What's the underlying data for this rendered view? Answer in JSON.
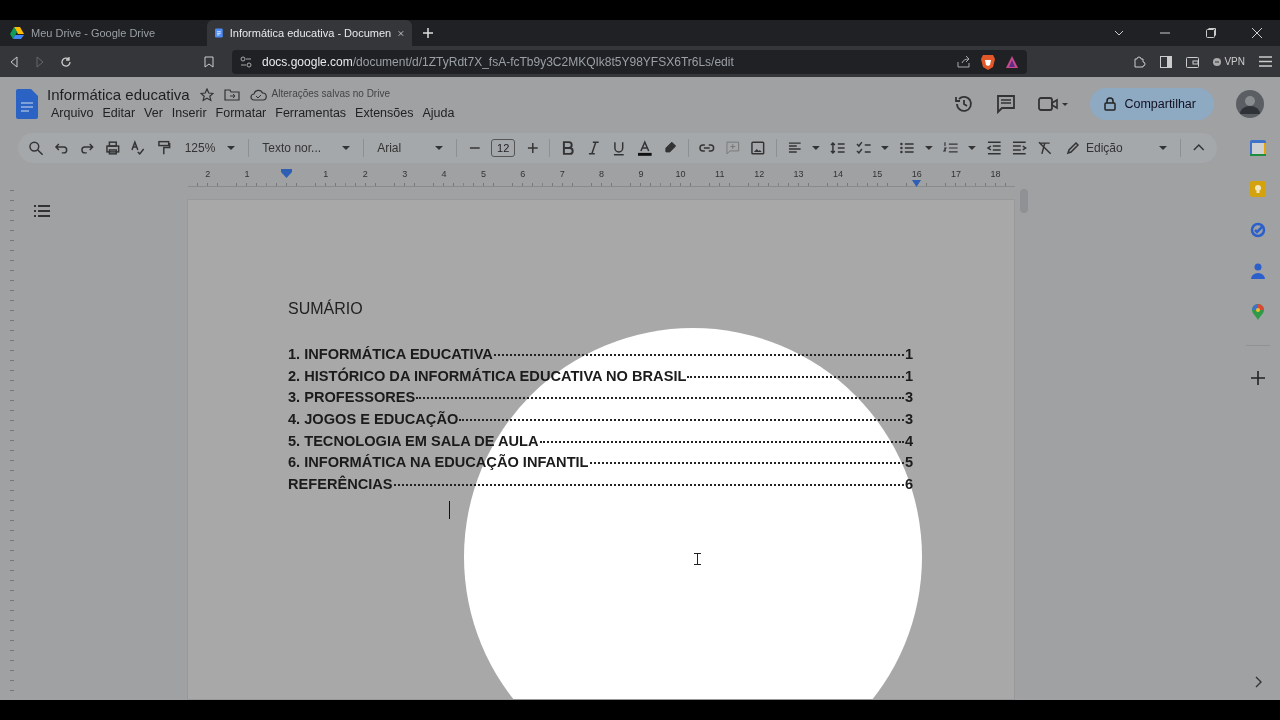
{
  "browser": {
    "tabs": [
      {
        "title": "Meu Drive - Google Drive",
        "kind": "drive",
        "selected": false
      },
      {
        "title": "Informática educativa - Documen",
        "kind": "docs",
        "selected": true
      }
    ],
    "url": {
      "host": "docs.google.com",
      "path": "/document/d/1ZTyRdt7X_fsA-fcTb9y3C2MKQIk8t5Y98YFSX6Tr6Ls/edit"
    },
    "vpn": "VPN"
  },
  "document_title": "Informática educativa",
  "save_status": "Alterações salvas no Drive",
  "menu": [
    "Arquivo",
    "Editar",
    "Ver",
    "Inserir",
    "Formatar",
    "Ferramentas",
    "Extensões",
    "Ajuda"
  ],
  "share_button": "Compartilhar",
  "toolbar": {
    "zoom": "125%",
    "paragraph_style": "Texto nor...",
    "font": "Arial",
    "font_size": "12",
    "mode": "Edição"
  },
  "ruler": {
    "left_labels": [
      "2",
      "1"
    ],
    "right_labels": [
      "1",
      "2",
      "3",
      "4",
      "5",
      "6",
      "7",
      "8",
      "9",
      "10",
      "11",
      "12",
      "13",
      "14",
      "15",
      "16",
      "17",
      "18"
    ]
  },
  "page": {
    "heading": "SUMÁRIO",
    "toc": [
      {
        "title": "1. INFORMÁTICA EDUCATIVA",
        "page": "1"
      },
      {
        "title": "2. HISTÓRICO DA INFORMÁTICA EDUCATIVA NO BRASIL",
        "page": "1"
      },
      {
        "title": "3. PROFESSORES",
        "page": "3"
      },
      {
        "title": "4. JOGOS E EDUCAÇÃO",
        "page": "3"
      },
      {
        "title": "5. TECNOLOGIA EM SALA DE AULA",
        "page": "4"
      },
      {
        "title": "6. INFORMÁTICA NA EDUCAÇÃO INFANTIL",
        "page": "5"
      },
      {
        "title": "REFERÊNCIAS",
        "page": "6"
      }
    ]
  }
}
